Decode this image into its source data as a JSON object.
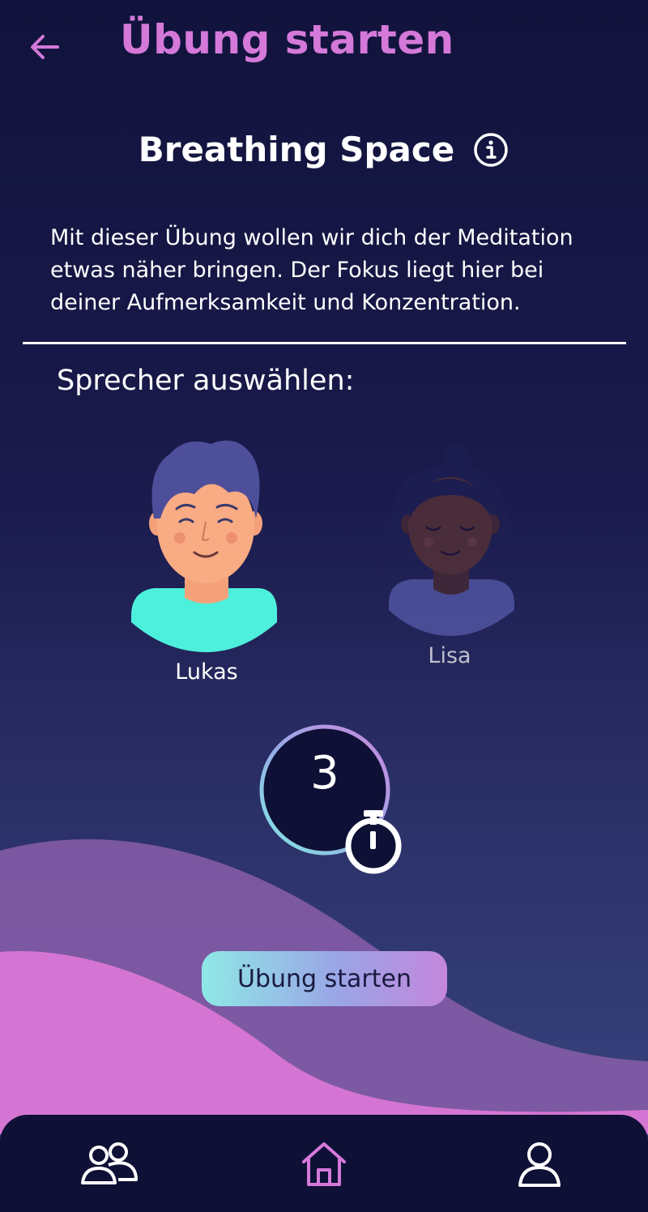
{
  "header": {
    "title": "Übung starten"
  },
  "exercise": {
    "title": "Breathing Space",
    "description": "Mit dieser Übung wollen wir dich der Meditation etwas näher bringen. Der Fokus liegt hier bei deiner Aufmerksamkeit und Konzentration."
  },
  "speakers": {
    "label": "Sprecher auswählen:",
    "items": [
      {
        "name": "Lukas",
        "selected": true
      },
      {
        "name": "Lisa",
        "selected": false
      }
    ]
  },
  "timer": {
    "value": "3"
  },
  "start_button": {
    "label": "Übung starten"
  },
  "nav": {
    "items": [
      {
        "icon": "community-icon"
      },
      {
        "icon": "home-icon",
        "active": true
      },
      {
        "icon": "profile-icon"
      }
    ]
  },
  "colors": {
    "accent": "#d479d9",
    "background_top": "#11133c",
    "background_bottom": "#3b4783",
    "button_gradient_start": "#8ee9e6",
    "button_gradient_end": "#c486dc",
    "nav_background": "#0f1035"
  }
}
